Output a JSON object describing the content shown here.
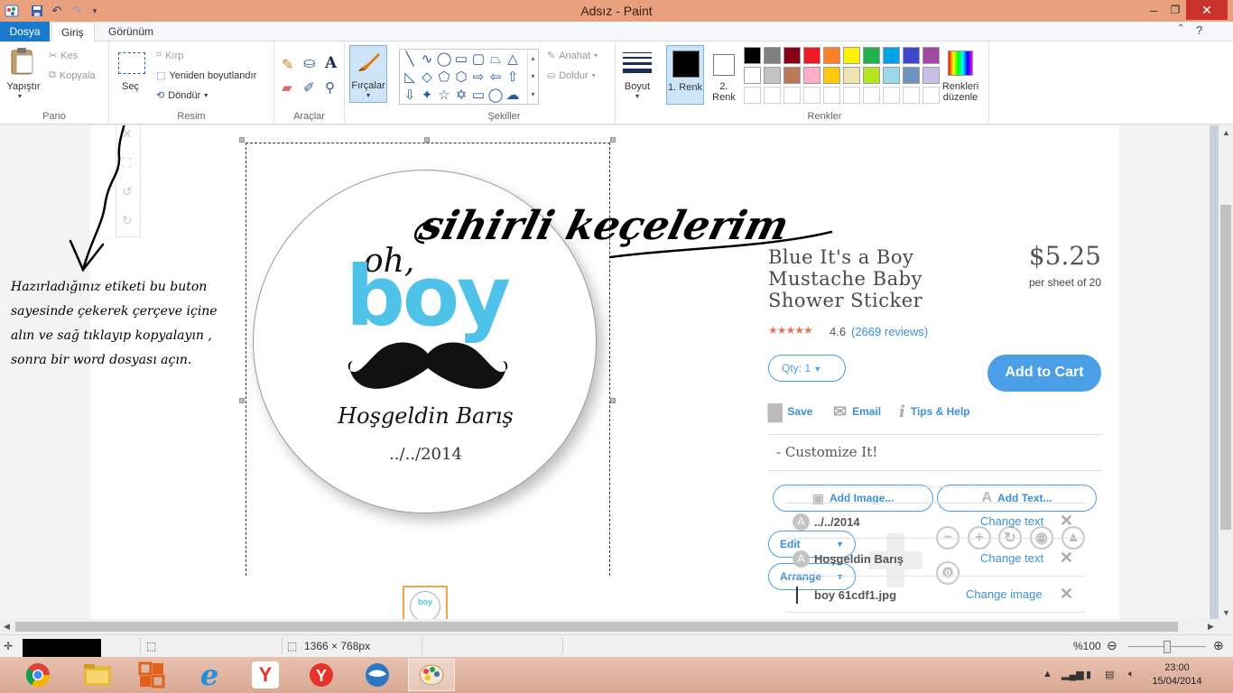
{
  "window": {
    "title": "Adsız - Paint",
    "minimize": "‒",
    "restore": "❐",
    "close": "✕"
  },
  "ribbon": {
    "tabs": [
      "Dosya",
      "Giriş",
      "Görünüm"
    ],
    "clipboard": {
      "paste": "Yapıştır",
      "cut": "Kes",
      "copy": "Kopyala",
      "label": "Pano"
    },
    "image": {
      "select": "Seç",
      "crop": "Kırp",
      "resize": "Yeniden boyutlandır",
      "rotate": "Döndür",
      "label": "Resim"
    },
    "tools": {
      "label": "Araçlar"
    },
    "brushes": {
      "label": "Fırçalar"
    },
    "shapes": {
      "outline": "Anahat",
      "fill": "Doldur",
      "label": "Şekiller"
    },
    "size": {
      "label": "Boyut"
    },
    "colors": {
      "color1": "1. Renk",
      "color2": "2. Renk",
      "edit": "Renkleri düzenle",
      "label": "Renkler",
      "palette_row1": [
        "#000000",
        "#7f7f7f",
        "#880015",
        "#ed1c24",
        "#ff7f27",
        "#fff200",
        "#22b14c",
        "#00a2e8",
        "#3f48cc",
        "#a349a4"
      ],
      "palette_row2": [
        "#ffffff",
        "#c3c3c3",
        "#b97a57",
        "#ffaec9",
        "#ffc90e",
        "#efe4b0",
        "#b5e61d",
        "#99d9ea",
        "#7092be",
        "#c8bfe7"
      ]
    }
  },
  "annotation": {
    "instructions": "Hazırladığınız etiketi bu buton sayesinde çekerek çerçeve içine alın ve sağ tıklayıp kopyalayın , sonra bir word dosyası açın.",
    "signature": "sihirli keçelerim"
  },
  "sticker": {
    "oh": "oh,",
    "boy": "boy",
    "name": "Hoşgeldin Barış",
    "date": "../../2014"
  },
  "product": {
    "title": "Blue It's a Boy Mustache Baby Shower Sticker",
    "price": "$5.25",
    "per_sheet": "per sheet of 20",
    "rating": "4.6",
    "reviews": "(2669 reviews)",
    "rating_value": 4.6,
    "qty_label": "Qty: 1",
    "add_to_cart": "Add to Cart",
    "actions": {
      "save": "Save",
      "email": "Email",
      "tips": "Tips & Help"
    },
    "customize": "-  Customize It!",
    "add_image": "Add Image...",
    "add_text": "Add Text...",
    "edit": "Edit",
    "arrange": "Arrange",
    "layers": [
      {
        "name": "../../2014",
        "action": "Change text",
        "badge": "A"
      },
      {
        "name": "Hoşgeldin Barış",
        "action": "Change text",
        "badge": "A"
      },
      {
        "name": "boy 61cdf1.jpg",
        "action": "Change image",
        "badge": "img"
      }
    ]
  },
  "status": {
    "dimensions": "1366 × 768px",
    "zoom": "%100"
  },
  "taskbar": {
    "time": "23:00",
    "date": "15/04/2014"
  }
}
